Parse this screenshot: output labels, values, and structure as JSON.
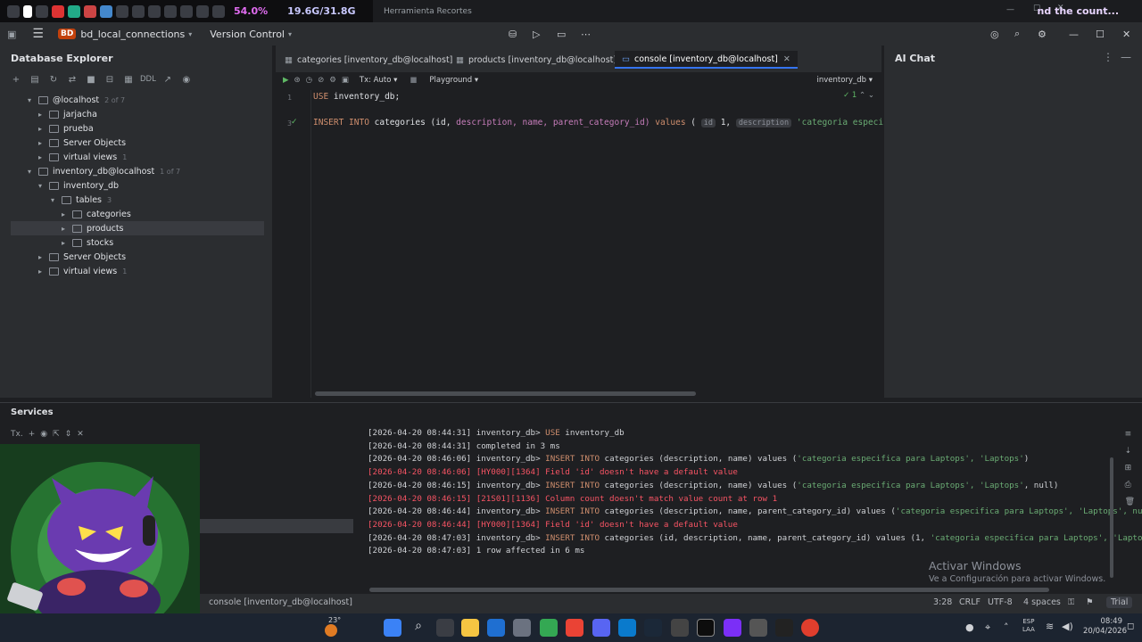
{
  "systray": {
    "cpu": "54.0%",
    "ram": "19.6G/31.8G"
  },
  "snip": {
    "title": "Herramienta Recortes",
    "ext_text": "nd the count..."
  },
  "titlebar": {
    "project": "bd_local_connections",
    "project_badge": "BD",
    "vcs": "Version Control"
  },
  "db_explorer": {
    "title": "Database Explorer",
    "toolbar_ddl": "DDL",
    "tree": [
      {
        "label": "@localhost",
        "count": "2 of 7",
        "depth": 0,
        "expanded": true
      },
      {
        "label": "jarjacha",
        "count": "",
        "depth": 1,
        "expanded": false
      },
      {
        "label": "prueba",
        "count": "",
        "depth": 1,
        "expanded": false
      },
      {
        "label": "Server Objects",
        "count": "",
        "depth": 1,
        "expanded": false
      },
      {
        "label": "virtual views",
        "count": "1",
        "depth": 1,
        "expanded": false
      },
      {
        "label": "inventory_db@localhost",
        "count": "1 of 7",
        "depth": 0,
        "expanded": true
      },
      {
        "label": "inventory_db",
        "count": "",
        "depth": 1,
        "expanded": true
      },
      {
        "label": "tables",
        "count": "3",
        "depth": 2,
        "expanded": true
      },
      {
        "label": "categories",
        "count": "",
        "depth": 3,
        "expanded": false
      },
      {
        "label": "products",
        "count": "",
        "depth": 3,
        "expanded": false,
        "selected": true
      },
      {
        "label": "stocks",
        "count": "",
        "depth": 3,
        "expanded": false
      },
      {
        "label": "Server Objects",
        "count": "",
        "depth": 1,
        "expanded": false
      },
      {
        "label": "virtual views",
        "count": "1",
        "depth": 1,
        "expanded": false
      }
    ]
  },
  "editor": {
    "tabs": [
      {
        "label": "categories [inventory_db@localhost]"
      },
      {
        "label": "products [inventory_db@localhost]"
      },
      {
        "label": "console [inventory_db@localhost]",
        "active": true
      }
    ],
    "tx_mode": "Tx: Auto",
    "playground": "Playground",
    "schema": "inventory_db",
    "check_count": "1",
    "lines": {
      "n1": "1",
      "n3": "3",
      "l1_kw": "USE",
      "l1_rest": " inventory_db;",
      "l3_kw": "INSERT INTO",
      "l3_a": " categories (id,",
      "l3_b": " description, name,",
      "l3_c": " parent_category_id) ",
      "l3_values": "values",
      "l3_d": " ( ",
      "hint_id": "id",
      "l3_one": " 1, ",
      "hint_desc": "description",
      "l3_str": " 'categoria especifica para L"
    }
  },
  "ai_chat": {
    "title": "AI Chat"
  },
  "services": {
    "title": "Services",
    "tx_label": "Tx.",
    "log": [
      {
        "ts": "[2026-04-20 08:44:31]",
        "src": " inventory_db> ",
        "kw": "USE",
        "rest": " inventory_db",
        "err": false
      },
      {
        "ts": "[2026-04-20 08:44:31]",
        "src": " completed in 3 ms",
        "kw": "",
        "rest": "",
        "err": false
      },
      {
        "ts": "[2026-04-20 08:46:06]",
        "src": " inventory_db> ",
        "kw": "INSERT INTO",
        "rest": " categories (description, name) values (",
        "str": "'categoria especifica para Laptops', 'Laptops'",
        "tail": ")",
        "err": false
      },
      {
        "ts": "[2026-04-20 08:46:06]",
        "src": " [HY000][1364] Field 'id' doesn't have a default value",
        "kw": "",
        "rest": "",
        "err": true
      },
      {
        "ts": "[2026-04-20 08:46:15]",
        "src": " inventory_db> ",
        "kw": "INSERT INTO",
        "rest": " categories (description, name) values (",
        "str": "'categoria especifica para Laptops', 'Laptops'",
        "tail": ", null)",
        "err": false
      },
      {
        "ts": "[2026-04-20 08:46:15]",
        "src": " [21S01][1136] Column count doesn't match value count at row 1",
        "kw": "",
        "rest": "",
        "err": true
      },
      {
        "ts": "[2026-04-20 08:46:44]",
        "src": " inventory_db> ",
        "kw": "INSERT INTO",
        "rest": " categories (description, name, parent_category_id) values (",
        "str": "'categoria especifica para Laptops', 'Laptops', nu",
        "tail": "",
        "err": false
      },
      {
        "ts": "[2026-04-20 08:46:44]",
        "src": " [HY000][1364] Field 'id' doesn't have a default value",
        "kw": "",
        "rest": "",
        "err": true
      },
      {
        "ts": "[2026-04-20 08:47:03]",
        "src": " inventory_db> ",
        "kw": "INSERT INTO",
        "rest": " categories (id, description, name, parent_category_id) values (1, ",
        "str": "'categoria especifica para Laptops', 'Lapto",
        "tail": "",
        "err": false
      },
      {
        "ts": "[2026-04-20 08:47:03]",
        "src": " 1 row affected in 6 ms",
        "kw": "",
        "rest": "",
        "err": false
      }
    ],
    "watermark_title": "Activar Windows",
    "watermark_sub": "Ve a Configuración para activar Windows."
  },
  "status": {
    "console": "console [inventory_db@localhost]",
    "position": "3:28",
    "eol": "CRLF",
    "encoding": "UTF-8",
    "indent": "4 spaces",
    "license": "Trial"
  },
  "taskbar": {
    "weather": "23°",
    "lang": "ESP",
    "lang2": "LAA",
    "time": "08:49",
    "date": "20/04/2026"
  },
  "colors": {
    "accent": "#3574f0",
    "error": "#f75464",
    "keyword": "#cf8e6d",
    "string": "#6aab73"
  }
}
